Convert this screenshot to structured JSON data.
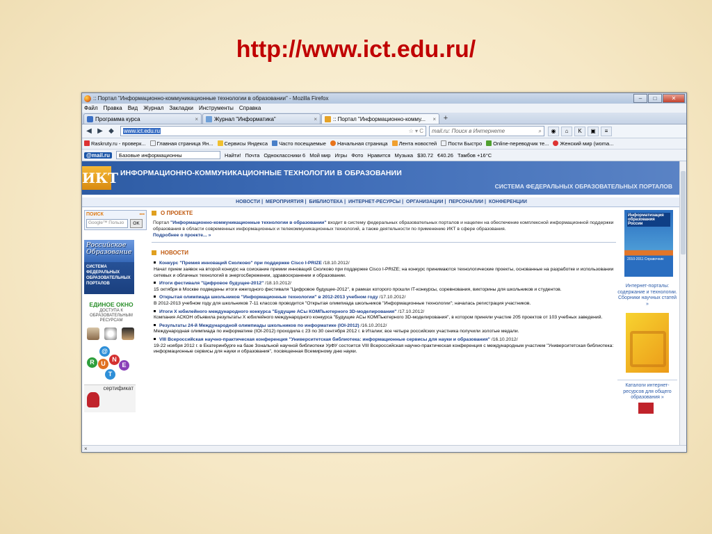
{
  "slide": {
    "title": "http://www.ict.edu.ru/"
  },
  "window": {
    "title": ":: Портал \"Информационно-коммуникационные технологии в образовании\" - Mozilla Firefox",
    "menu": [
      "Файл",
      "Правка",
      "Вид",
      "Журнал",
      "Закладки",
      "Инструменты",
      "Справка"
    ],
    "tabs": [
      {
        "label": "Программа курса",
        "active": false
      },
      {
        "label": "Журнал \"Информатика\"",
        "active": false
      },
      {
        "label": ":: Портал \"Информационно-комму...",
        "active": true
      }
    ],
    "url": "www.ict.edu.ru",
    "search_placeholder": "mail.ru: Поиск в Интернете",
    "bookmarks": [
      "Raskruty.ru - проверк...",
      "Главная страница Ян...",
      "Сервисы Яндекса",
      "Часто посещаемые",
      "Начальная страница",
      "Лента новостей",
      "Пости Быстро",
      "Online-переводчик те...",
      "Женский мир (woma..."
    ],
    "mailbar": {
      "logo": "@mail.ru",
      "search_value": "Базовые информационны",
      "find_label": "Найти!",
      "items": [
        "Почта",
        "Одноклассники 6",
        "Мой мир",
        "Игры",
        "Фото",
        "Нравится",
        "Музыка",
        "$30.72",
        "€40.26",
        "Тамбов +16°C"
      ]
    },
    "status": "×"
  },
  "site": {
    "logo": "ИКТ",
    "header_title": "ИНФОРМАЦИОННО-КОММУНИКАЦИОННЫЕ ТЕХНОЛОГИИ В ОБРАЗОВАНИИ",
    "header_subtitle": "СИСТЕМА ФЕДЕРАЛЬНЫХ ОБРАЗОВАТЕЛЬНЫХ ПОРТАЛОВ",
    "nav": [
      "НОВОСТИ",
      "МЕРОПРИЯТИЯ",
      "БИБЛИОТЕКА",
      "ИНТЕРНЕТ-РЕСУРСЫ",
      "ОРГАНИЗАЦИИ",
      "ПЕРСОНАЛИИ",
      "КОНФЕРЕНЦИИ"
    ],
    "left": {
      "search_label": "ПОИСК",
      "search_placeholder": "Google™ Пользо",
      "ok_label": "OK",
      "russian_edu": "Российское Образование",
      "federal_portals": "СИСТЕМА ФЕДЕРАЛЬНЫХ ОБРАЗОВАТЕЛЬНЫХ ПОРТАЛОВ",
      "edin_title": "ЕДИНОЕ ОКНО",
      "edin_sub": "ДОСТУПА К ОБРАЗОВАТЕЛЬНЫМ РЕСУРСАМ",
      "cert_label": "сертификат"
    },
    "about": {
      "heading": "О ПРОЕКТЕ",
      "text_pre": "Портал ",
      "text_bold": "\"Информационно-коммуникационные технологии в образовании\"",
      "text_post": " входит в систему федеральных образовательных порталов и нацелен на обеспечение комплексной информационной поддержки образования в области современных информационных и телекоммуникационных технологий, а также деятельности по применению ИКТ в сфере образования.",
      "more": "Подробнее о проекте... »"
    },
    "news_heading": "НОВОСТИ",
    "news": [
      {
        "title": "Конкурс \"Премия инноваций Сколково\" при поддержке Cisco I-PRIZE",
        "date": " /18.10.2012/",
        "text": "Начат прием заявок на второй конкурс на соискание премии инноваций Сколково при поддержке Cisco I-PRIZE; на конкурс принимаются технологические проекты, основанные на разработке и использовании сетевых и облачных технологий в энергосбережении, здравоохранении и образовании."
      },
      {
        "title": "Итоги фестиваля \"Цифровое будущее-2012\"",
        "date": " /18.10.2012/",
        "text": "15 октября в Москве подведены итоги ежегодного фестиваля \"Цифровое будущее-2012\", в рамках которого прошли IT-конкурсы, соревнования, викторины для школьников и студентов."
      },
      {
        "title": "Открытая олимпиада школьников \"Информационные технологии\" в 2012-2013 учебном году",
        "date": " /17.10.2012/",
        "text": "В 2012-2013 учебном году для школьников 7-11 классов проводится \"Открытая олимпиада школьников \"Информационные технологии\"; началась регистрация участников."
      },
      {
        "title": "Итоги X юбилейного международного конкурса \"Будущие АСы КОМПьютерного 3D-моделирования\"",
        "date": " /17.10.2012/",
        "text": "Компания АСКОН объявила результаты X юбилейного международного конкурса \"Будущие АСы КОМПьютерного 3D-моделирования\", в котором приняли участие 205 проектов от 103 учебных заведений."
      },
      {
        "title": "Результаты 24-й Международной олимпиады школьников по информатике (IOI-2012)",
        "date": " /16.10.2012/",
        "text": "Международная олимпиада по информатике (IOI-2012) проходила с 23 по 30 сентября 2012 г. в Италии; все четыре российских участника получили золотые медали."
      },
      {
        "title": "VIII Всероссийская научно-практическая конференция \"Университетская библиотека: информационные сервисы для науки и образования\"",
        "date": " /16.10.2012/",
        "text": "19-22 ноября 2012 г. в Екатеринбурге на базе Зональной научной библиотеки УрФУ состоится VIII Всероссийская научно-практическая конференция с международным участием \"Университетская библиотека: информационные сервисы для науки и образования\", посвященная Всемирному дню науки."
      }
    ],
    "right": {
      "book_title": "Информатизация образования России",
      "book_years": "2010-2011 Справочник",
      "portals_link": "Интернет-порталы: содержание и технологии. Сборники научных статей »",
      "catalog_link": "Каталоги интернет-ресурсов для общего образования »"
    }
  }
}
